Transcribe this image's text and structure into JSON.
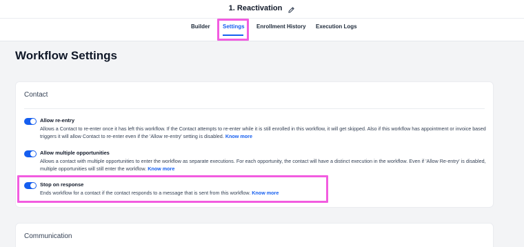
{
  "header": {
    "workflow_title": "1. Reactivation",
    "tabs": [
      "Builder",
      "Settings",
      "Enrollment History",
      "Execution Logs"
    ],
    "active_tab": "Settings"
  },
  "page": {
    "title": "Workflow Settings"
  },
  "contact_card": {
    "title": "Contact",
    "settings": [
      {
        "label": "Allow re-entry",
        "enabled": true,
        "description_line1": "Allows a Contact to re-enter once it has left this workflow. If the Contact attempts to re-enter while it is still enrolled in this workflow, it will get skipped. Also if this workflow has",
        "description_line2": "appointment or invoice based triggers it will allow Contact to re-enter even if the 'Allow re-entry' setting is disabled.",
        "link": "Know more"
      },
      {
        "label": "Allow multiple opportunities",
        "enabled": true,
        "description_line1": "Allows a contact with multiple opportunities to enter the workflow as separate executions. For each opportunity, the contact will have a distinct execution in the workflow. Even if",
        "description_line2": "'Allow Re-entry' is disabled, multiple opportunities will still enter the workflow.",
        "link": "Know more"
      },
      {
        "label": "Stop on response",
        "enabled": true,
        "description_line1": "Ends workflow for a contact if the contact responds to a message that is sent from this workflow.",
        "link": "Know more"
      }
    ]
  },
  "communication_card": {
    "title": "Communication"
  },
  "colors": {
    "accent": "#155eef",
    "highlight": "#f25ce0"
  }
}
